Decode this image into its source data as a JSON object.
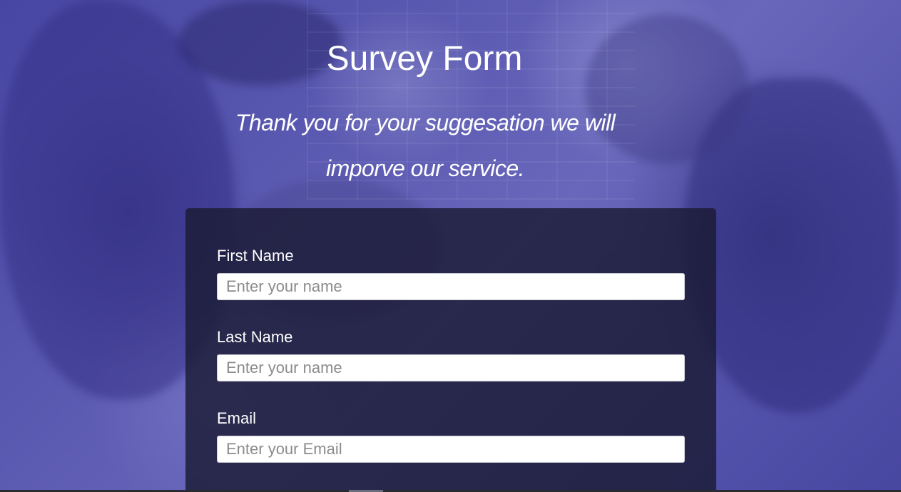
{
  "header": {
    "title": "Survey Form",
    "description": "Thank you for your suggesation we will imporve our service."
  },
  "form": {
    "fields": [
      {
        "label": "First Name",
        "placeholder": "Enter your name",
        "value": ""
      },
      {
        "label": "Last Name",
        "placeholder": "Enter your name",
        "value": ""
      },
      {
        "label": "Email",
        "placeholder": "Enter your Email",
        "value": ""
      }
    ]
  },
  "colors": {
    "background": "#4b4aa3",
    "card": "#1b1b34",
    "text": "#ffffff"
  }
}
